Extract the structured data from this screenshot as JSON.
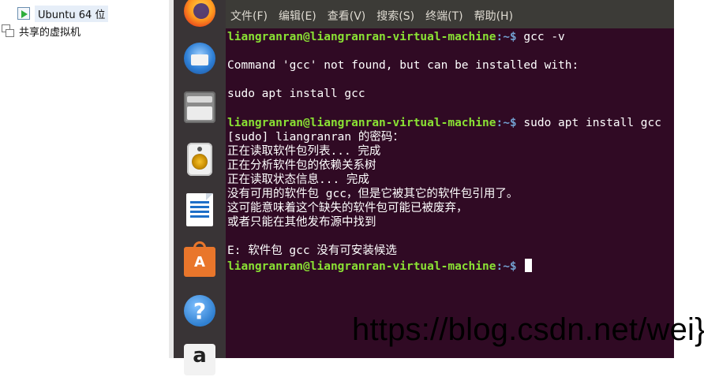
{
  "library": {
    "vm_name": "Ubuntu 64 位",
    "shared_label": "共享的虚拟机"
  },
  "dock": {
    "apps": [
      "firefox",
      "thunderbird",
      "files",
      "rhythmbox",
      "libreoffice-writer",
      "ubuntu-software",
      "help",
      "amazon"
    ],
    "help_glyph": "?",
    "software_glyph": "A",
    "amazon_glyph": "a"
  },
  "terminal": {
    "menus": [
      "文件(F)",
      "编辑(E)",
      "查看(V)",
      "搜索(S)",
      "终端(T)",
      "帮助(H)"
    ],
    "prompt_user": "liangranran@liangranran-virtual-machine",
    "prompt_path": ":~$",
    "lines": {
      "cmd1": " gcc -v",
      "l2": "Command 'gcc' not found, but can be installed with:",
      "l4": "sudo apt install gcc",
      "cmd2": " sudo apt install gcc",
      "l7": "[sudo] liangranran 的密码：",
      "l8": "正在读取软件包列表... 完成",
      "l9": "正在分析软件包的依赖关系树",
      "l10": "正在读取状态信息... 完成",
      "l11": "没有可用的软件包 gcc，但是它被其它的软件包引用了。",
      "l12": "这可能意味着这个缺失的软件包可能已被废弃，",
      "l13": "或者只能在其他发布源中找到",
      "l15": "E: 软件包 gcc 没有可安装候选"
    },
    "colors": {
      "background": "#300a24",
      "prompt_user": "#8ae234",
      "prompt_path": "#729fcf",
      "menubar": "#3c3b37"
    }
  },
  "watermark": "https://blog.csdn.net/wei}"
}
